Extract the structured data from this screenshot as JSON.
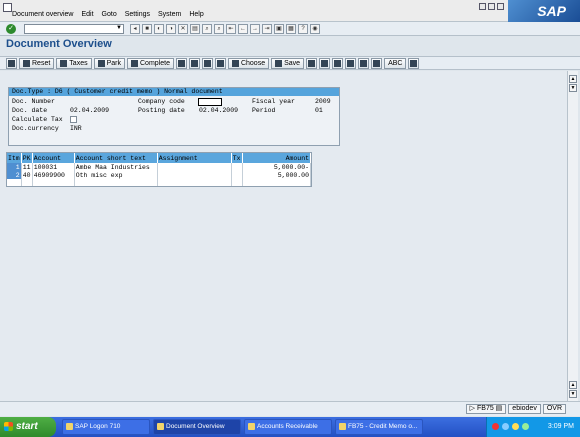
{
  "menu": [
    "Document overview",
    "Edit",
    "Goto",
    "Settings",
    "System",
    "Help"
  ],
  "brand": "SAP",
  "command_field": "",
  "page_title": "Document Overview",
  "toolbar": {
    "reset": "Reset",
    "taxes": "Taxes",
    "park": "Park",
    "complete": "Complete",
    "choose": "Choose",
    "save": "Save",
    "abc": "ABC"
  },
  "header": {
    "doc_type_line": "Doc.Type : D6 ( Customer credit memo ) Normal document",
    "doc_number_label": "Doc. Number",
    "company_code_label": "Company code",
    "company_code_value": "",
    "fiscal_year_label": "Fiscal year",
    "fiscal_year_value": "2009",
    "doc_date_label": "Doc. date",
    "doc_date_value": "02.04.2009",
    "posting_date_label": "Posting date",
    "posting_date_value": "02.04.2009",
    "period_label": "Period",
    "period_value": "01",
    "calculate_tax_label": "Calculate Tax",
    "doc_currency_label": "Doc.currency",
    "doc_currency_value": "INR"
  },
  "items": {
    "columns": [
      "Itm",
      "PK",
      "Account",
      "Account short text",
      "Assignment",
      "Tx",
      "Amount"
    ],
    "rows": [
      {
        "itm": "1",
        "pk": "11",
        "account": "100031",
        "text": "Ambe Maa Industries",
        "assignment": "",
        "tx": "",
        "amount": "5,000.00-"
      },
      {
        "itm": "2",
        "pk": "40",
        "account": "46909900",
        "text": "Oth misc exp",
        "assignment": "",
        "tx": "",
        "amount": "5,000.00"
      }
    ]
  },
  "status": {
    "transaction": "FB75",
    "server": "ebiodev",
    "mode": "OVR"
  },
  "taskbar": {
    "start": "start",
    "tasks": [
      "SAP Logon 710",
      "Document Overview",
      "Accounts Receivable",
      "FB75 - Credit Memo o..."
    ],
    "clock": "3:09 PM"
  },
  "colors": {
    "title": "#1d4f8c",
    "header_bar": "#55a4dc",
    "taskbar": "#2350c4"
  }
}
